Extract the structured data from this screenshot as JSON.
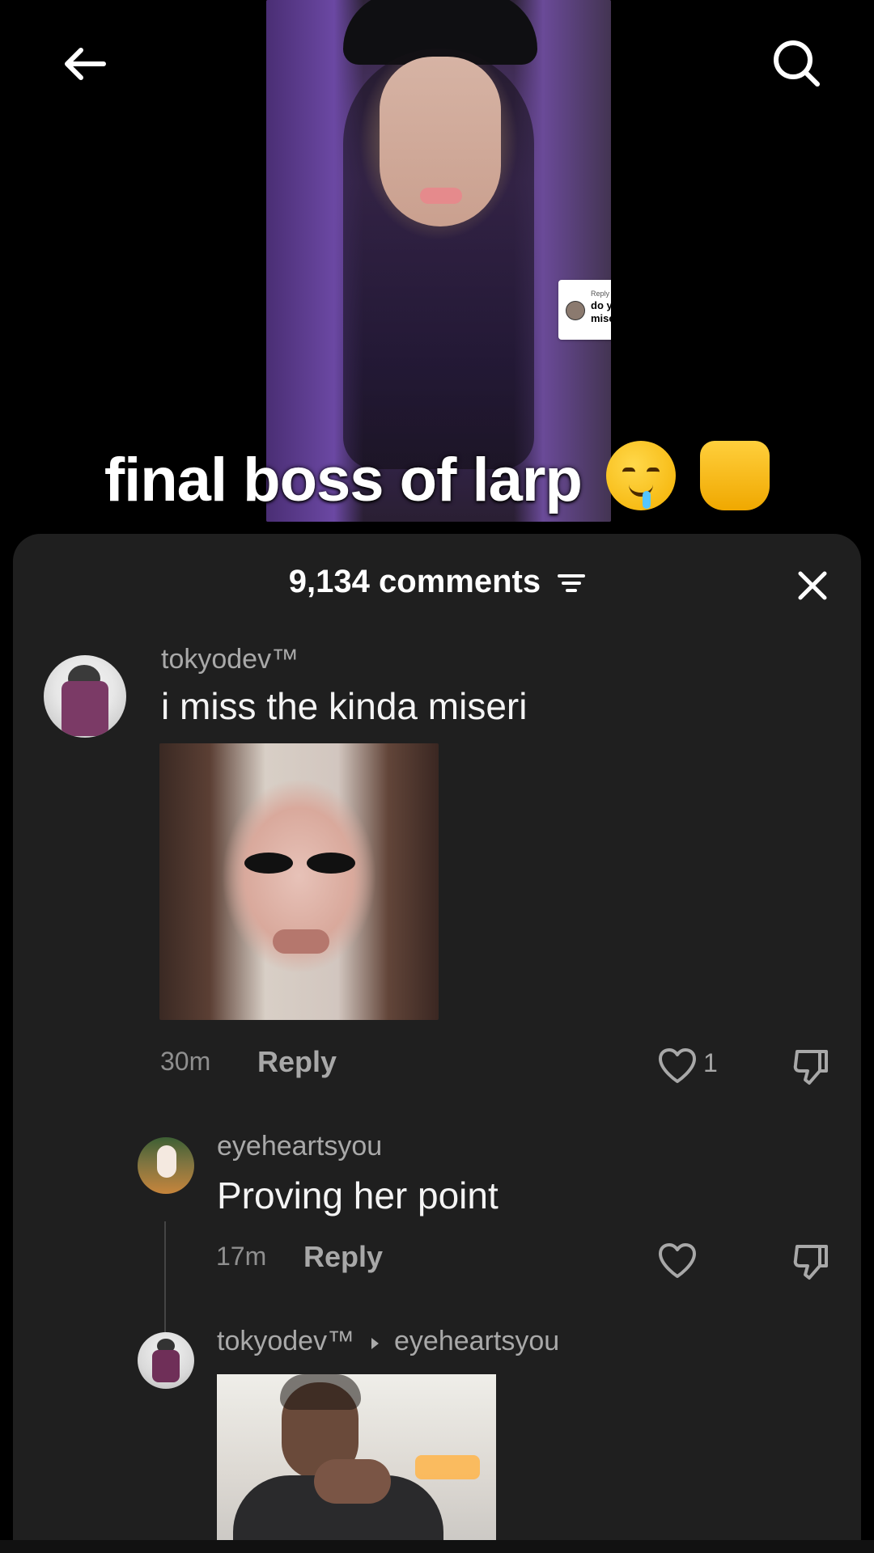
{
  "video": {
    "reply_label": "Reply to Abdullah's comment",
    "reply_comment": "do you like the song misery",
    "caption": "final boss of larp"
  },
  "top_bar": {
    "back_icon": "arrow-left-icon",
    "search_icon": "search-icon"
  },
  "comments_sheet": {
    "title": "9,134 comments",
    "filter_icon": "filter-icon",
    "close_icon": "close-icon"
  },
  "comments": [
    {
      "username": "tokyodev™",
      "text": "i miss the kinda miseri",
      "time": "30m",
      "reply_label": "Reply",
      "likes": "1",
      "has_image": true
    },
    {
      "username": "eyeheartsyou",
      "text": "Proving her point",
      "time": "17m",
      "reply_label": "Reply",
      "likes": "",
      "has_image": false
    },
    {
      "username": "tokyodev™",
      "reply_to": "eyeheartsyou",
      "text": "",
      "has_image": true
    }
  ],
  "colors": {
    "background": "#000000",
    "sheet": "#1f1f1f",
    "text_primary": "#f4f4f4",
    "text_secondary": "#a9a9a9"
  }
}
